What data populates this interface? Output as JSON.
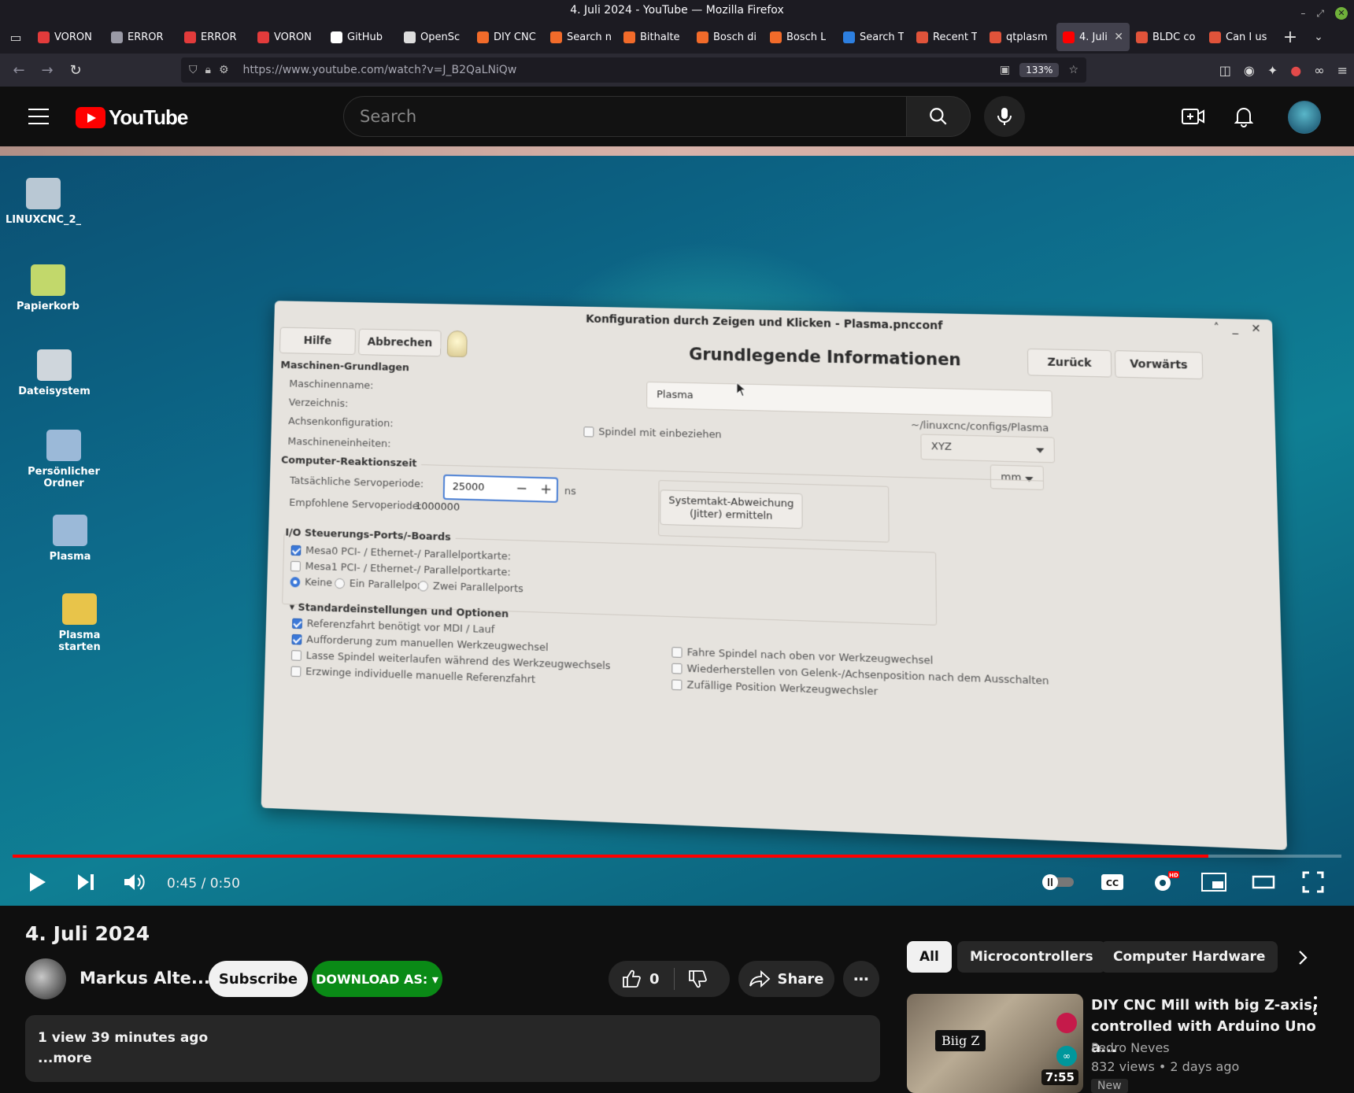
{
  "window": {
    "title": "4. Juli 2024 - YouTube — Mozilla Firefox"
  },
  "tabs": [
    {
      "label": "VORON",
      "color": "#e23b3b",
      "active": false
    },
    {
      "label": "ERROR",
      "color": "#9a9aa6",
      "active": false
    },
    {
      "label": "ERROR",
      "color": "#e23b3b",
      "active": false
    },
    {
      "label": "VORON",
      "color": "#e23b3b",
      "active": false
    },
    {
      "label": "GitHub",
      "color": "#ffffff",
      "active": false
    },
    {
      "label": "OpenSc",
      "color": "#dddddd",
      "active": false
    },
    {
      "label": "DIY CNC",
      "color": "#f26b2a",
      "active": false
    },
    {
      "label": "Search n",
      "color": "#f26b2a",
      "active": false
    },
    {
      "label": "Bithalte",
      "color": "#f26b2a",
      "active": false
    },
    {
      "label": "Bosch di",
      "color": "#f26b2a",
      "active": false
    },
    {
      "label": "Bosch L",
      "color": "#f26b2a",
      "active": false
    },
    {
      "label": "Search T",
      "color": "#2d7fe0",
      "active": false
    },
    {
      "label": "Recent T",
      "color": "#e0533a",
      "active": false
    },
    {
      "label": "qtplasm",
      "color": "#e0533a",
      "active": false
    },
    {
      "label": "4. Juli",
      "color": "#ff0000",
      "active": true
    },
    {
      "label": "BLDC co",
      "color": "#e0533a",
      "active": false
    },
    {
      "label": "Can I us",
      "color": "#e0533a",
      "active": false
    }
  ],
  "navbar": {
    "url": "https://www.youtube.com/watch?v=J_B2QaLNiQw",
    "zoom": "133%"
  },
  "youtube": {
    "logo_text": "YouTube",
    "search_placeholder": "Search"
  },
  "video": {
    "desktop_icons": [
      {
        "label": "LINUXCNC_2_",
        "color": "#b9c8d4"
      },
      {
        "label": "Papierkorb",
        "color": "#c2d86b"
      },
      {
        "label": "Dateisystem",
        "color": "#cfd6dc"
      },
      {
        "label": "Persönlicher Ordner",
        "color": "#9bb9d8"
      },
      {
        "label": "Plasma",
        "color": "#9bb9d8"
      },
      {
        "label": "Plasma starten",
        "color": "#e8c44a"
      }
    ],
    "dialog": {
      "title": "Konfiguration durch Zeigen und Klicken - Plasma.pncconf",
      "help_button": "Hilfe",
      "cancel_button": "Abbrechen",
      "heading": "Grundlegende Informationen",
      "back_button": "Zurück",
      "forward_button": "Vorwärts",
      "section_basics": "Maschinen-Grundlagen",
      "label_machine_name": "Maschinenname:",
      "machine_name_value": "Plasma",
      "label_directory": "Verzeichnis:",
      "directory_value": "~/linuxcnc/configs/Plasma",
      "label_axis": "Achsenkonfiguration:",
      "spindle_checkbox": "Spindel mit einbeziehen",
      "axis_value": "XYZ",
      "label_units": "Maschineneinheiten:",
      "units_value": "mm",
      "section_latency": "Computer-Reaktionszeit",
      "label_actual_servo": "Tatsächliche Servoperiode:",
      "servo_value": "25000",
      "servo_unit": "ns",
      "label_recommended_servo": "Empfohlene Servoperiode:",
      "recommended_value": "1000000",
      "jitter_button_line1": "Systemtakt-Abweichung",
      "jitter_button_line2": "(Jitter) ermitteln",
      "section_io": "I/O Steuerungs-Ports/-Boards",
      "mesa0": "Mesa0 PCI- / Ethernet-/ Parallelportkarte:",
      "mesa1": "Mesa1 PCI- / Ethernet-/ Parallelportkarte:",
      "radio_none": "Keine",
      "radio_one": "Ein Parallelport",
      "radio_two": "Zwei Parallelports",
      "section_defaults": "▾ Standardeinstellungen und Optionen",
      "opt1": "Referenzfahrt benötigt vor MDI / Lauf",
      "opt2": "Aufforderung zum manuellen Werkzeugwechsel",
      "opt3": "Lasse Spindel weiterlaufen während des Werkzeugwechsels",
      "opt4": "Erzwinge individuelle manuelle Referenzfahrt",
      "opt5": "Fahre Spindel nach oben vor Werkzeugwechsel",
      "opt6": "Wiederherstellen von Gelenk-/Achsenposition nach dem Ausschalten",
      "opt7": "Zufällige Position Werkzeugwechsler"
    },
    "player": {
      "time": "0:45 / 0:50",
      "progress": 0.9
    }
  },
  "meta": {
    "title": "4. Juli 2024",
    "channel": "Markus Alte...",
    "subscribe": "Subscribe",
    "download": "DOWNLOAD AS: ▾",
    "likes": "0",
    "share": "Share",
    "views": "1 view  39 minutes ago",
    "more": "...more"
  },
  "chips": [
    "All",
    "Microcontrollers",
    "Computer Hardware"
  ],
  "recommendation": {
    "title": "DIY CNC Mill with big Z-axis, controlled with Arduino Uno a...",
    "channel": "Pedro Neves",
    "stats": "832 views  • 2 days ago",
    "badge": "New",
    "duration": "7:55",
    "thumb_text": "Biig Z"
  }
}
